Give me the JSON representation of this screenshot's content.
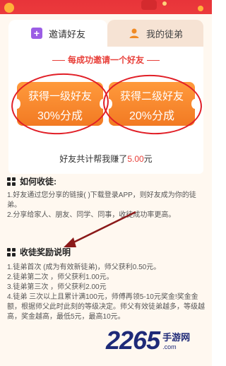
{
  "tabs": {
    "invite": "邀请好友",
    "disciples": "我的徒弟"
  },
  "subtitle": "每成功邀请一个好友",
  "rewards": [
    {
      "line1": "获得一级好友",
      "line2": "30%分成"
    },
    {
      "line1": "获得二级好友",
      "line2": "20%分成"
    }
  ],
  "earnings": {
    "prefix": "好友共计帮我赚了",
    "amount": "5.00",
    "suffix": "元"
  },
  "how_section": {
    "title": "如何收徒:",
    "items": [
      "1.好友通过您分享的链接(        )下载登录APP，则好友成为你的徒弟。",
      "2.分享给家人、朋友、同学、同事，收徒成功率更高。"
    ]
  },
  "rule_section": {
    "title": "收徒奖励说明",
    "items": [
      "1.徒弟首次        (成为有效新徒弟)，师父获利0.50元。",
      "2.徒弟第二次        ，师父获利1.00元。",
      "3.徒弟第三次        ，师父获利2.00元",
      "4.徒弟        三次以上且累计满100元，师傅再领5-10元奖金!奖金金额，根据师父此时此刻的等级决定。师父有效徒弟越多，等级越高，奖金越高，最低5元，最高10元。"
    ]
  },
  "watermark": {
    "number": "2265",
    "cn": "手游网",
    "domain": ".com"
  },
  "colors": {
    "accent": "#e8403a",
    "reward_orange": "#f27a23",
    "circle_red": "#e11f27"
  }
}
